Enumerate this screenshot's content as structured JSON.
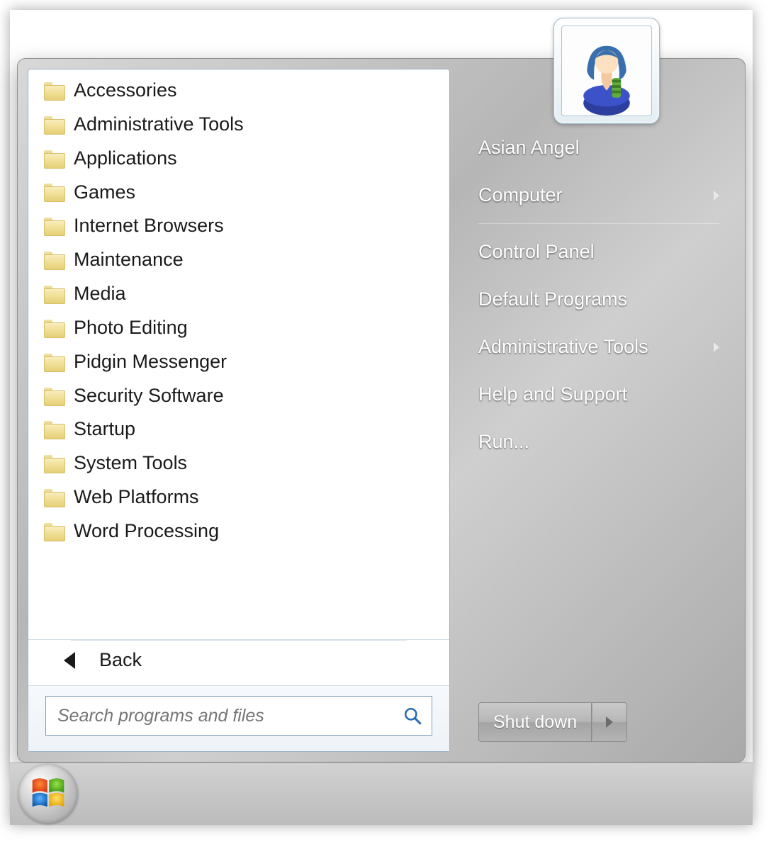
{
  "programs": [
    {
      "label": "Accessories"
    },
    {
      "label": "Administrative Tools"
    },
    {
      "label": "Applications"
    },
    {
      "label": "Games"
    },
    {
      "label": "Internet Browsers"
    },
    {
      "label": "Maintenance"
    },
    {
      "label": "Media"
    },
    {
      "label": "Photo Editing"
    },
    {
      "label": "Pidgin Messenger"
    },
    {
      "label": "Security Software"
    },
    {
      "label": "Startup"
    },
    {
      "label": "System Tools"
    },
    {
      "label": "Web Platforms"
    },
    {
      "label": "Word Processing"
    }
  ],
  "back_label": "Back",
  "search": {
    "placeholder": "Search programs and files"
  },
  "right_items": [
    {
      "label": "Asian Angel",
      "submenu": false,
      "sep_after": false
    },
    {
      "label": "Computer",
      "submenu": true,
      "sep_after": true
    },
    {
      "label": "Control Panel",
      "submenu": false,
      "sep_after": false
    },
    {
      "label": "Default Programs",
      "submenu": false,
      "sep_after": false
    },
    {
      "label": "Administrative Tools",
      "submenu": true,
      "sep_after": false
    },
    {
      "label": "Help and Support",
      "submenu": false,
      "sep_after": false
    },
    {
      "label": "Run...",
      "submenu": false,
      "sep_after": false
    }
  ],
  "shutdown": {
    "label": "Shut down"
  }
}
